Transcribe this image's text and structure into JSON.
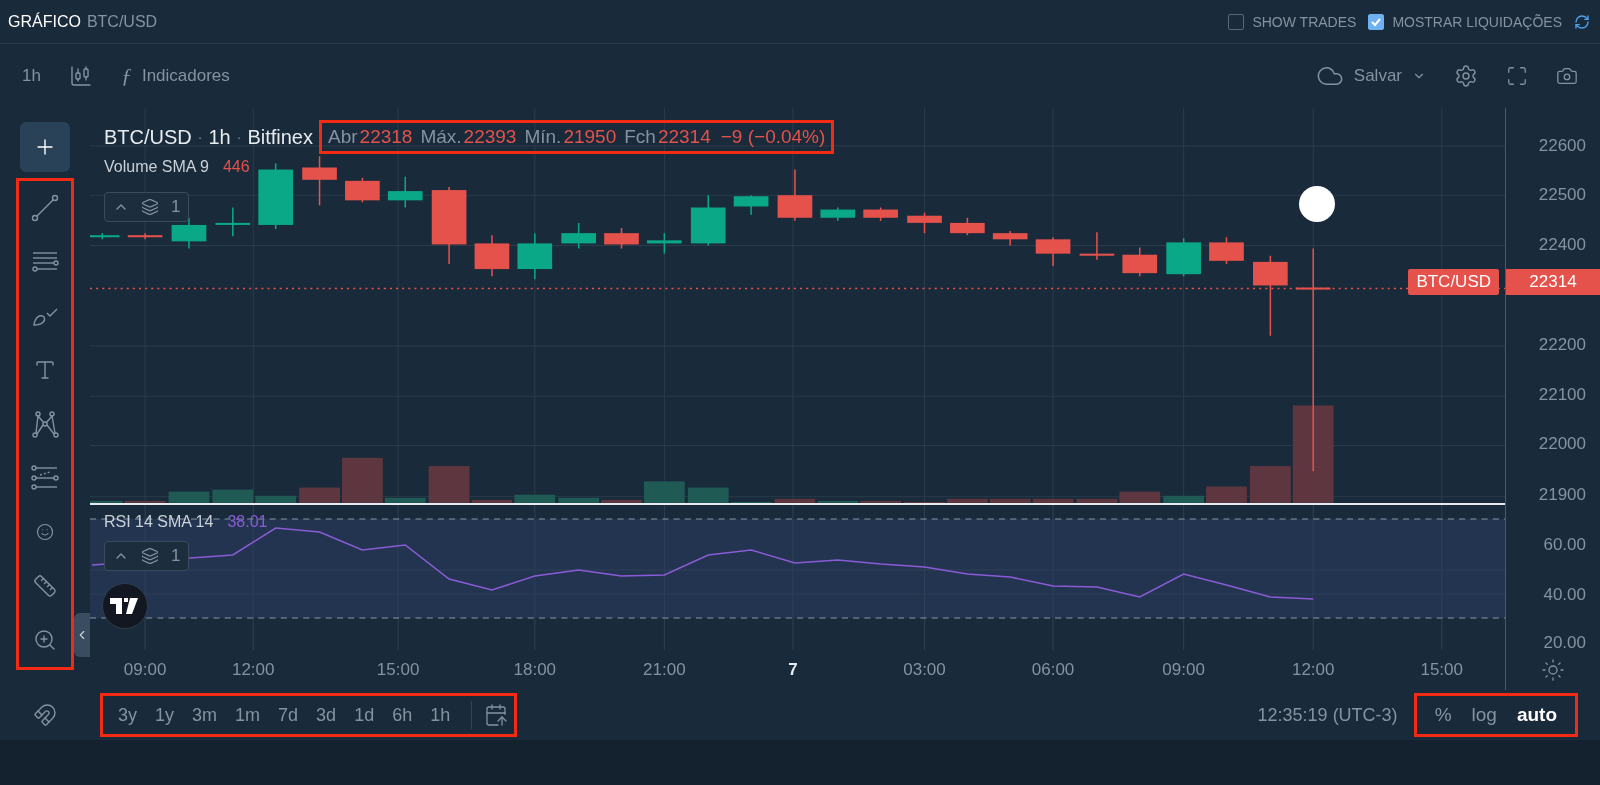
{
  "header": {
    "title": "GRÁFICO",
    "symbol": "BTC/USD"
  },
  "options": [
    {
      "label": "SHOW TRADES",
      "checked": false
    },
    {
      "label": "MOSTRAR LIQUIDAÇÕES",
      "checked": true
    }
  ],
  "toolbar": {
    "interval": "1h",
    "indicators_icon": "ƒ",
    "indicators": "Indicadores",
    "save": "Salvar"
  },
  "tools": [
    {
      "kind": "crosshair",
      "selected": true
    },
    {
      "kind": "trendline",
      "selected": false
    },
    {
      "kind": "lines",
      "selected": false
    },
    {
      "kind": "brush",
      "selected": false
    },
    {
      "kind": "text",
      "selected": false
    },
    {
      "kind": "pattern",
      "selected": false
    },
    {
      "kind": "fib",
      "selected": false
    },
    {
      "kind": "emoji",
      "selected": false
    },
    {
      "kind": "ruler",
      "selected": false
    },
    {
      "kind": "zoom",
      "selected": false
    },
    {
      "kind": "magnet",
      "selected": false
    }
  ],
  "legend": {
    "symbol": "BTC/USD",
    "separators": [
      "·",
      "·"
    ],
    "interval": "1h",
    "exchange": "Bitfinex",
    "ohlc": [
      {
        "label": "Abr",
        "value": "22318"
      },
      {
        "label": "Máx.",
        "value": "22393"
      },
      {
        "label": "Mín.",
        "value": "21950"
      },
      {
        "label": "Fch",
        "value": "22314"
      }
    ],
    "change": "−9 (−0.04%)"
  },
  "volume": {
    "name": "Volume SMA 9",
    "value": "446",
    "count": "1"
  },
  "last_price": {
    "symbol": "BTC/USD",
    "price": "22314"
  },
  "price_axis": [
    "22600",
    "22500",
    "22400",
    "22200",
    "22100",
    "22000",
    "21900"
  ],
  "rsi": {
    "name": "RSI 14 SMA 14",
    "value": "38.01",
    "count": "1",
    "axis": [
      "60.00",
      "40.00",
      "20.00"
    ]
  },
  "time_axis": [
    {
      "label": "09:00",
      "kind": "time"
    },
    {
      "label": "12:00",
      "kind": "time"
    },
    {
      "label": "15:00",
      "kind": "time"
    },
    {
      "label": "18:00",
      "kind": "time"
    },
    {
      "label": "21:00",
      "kind": "time"
    },
    {
      "label": "7",
      "kind": "day"
    },
    {
      "label": "03:00",
      "kind": "time"
    },
    {
      "label": "06:00",
      "kind": "time"
    },
    {
      "label": "09:00",
      "kind": "time"
    },
    {
      "label": "12:00",
      "kind": "time"
    },
    {
      "label": "15:00",
      "kind": "time"
    }
  ],
  "ranges": [
    "3y",
    "1y",
    "3m",
    "1m",
    "7d",
    "3d",
    "1d",
    "6h",
    "1h"
  ],
  "clock": "12:35:19 (UTC-3)",
  "scale_options": [
    {
      "label": "%",
      "selected": false
    },
    {
      "label": "log",
      "selected": false
    },
    {
      "label": "auto",
      "selected": true
    }
  ]
}
